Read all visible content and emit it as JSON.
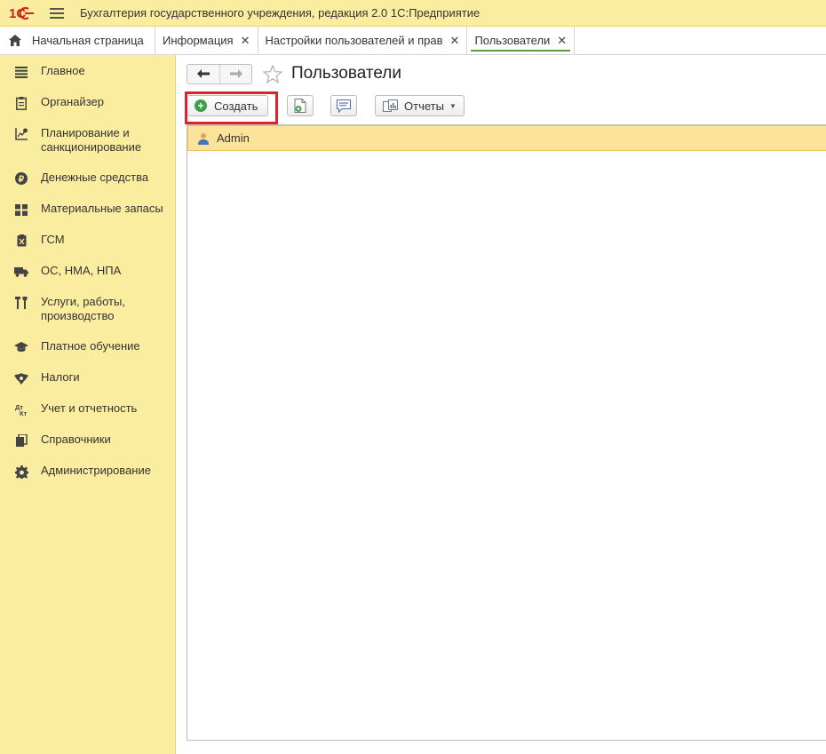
{
  "app": {
    "title": "Бухгалтерия государственного учреждения, редакция 2.0 1С:Предприятие",
    "brand_color": "#fbeda0",
    "accent_color": "#5a9e3e",
    "highlight_color": "#e0202a"
  },
  "tabs": [
    {
      "label": "Начальная страница",
      "icon": "home-icon",
      "closable": false,
      "active": false
    },
    {
      "label": "Информация",
      "closable": true,
      "active": false
    },
    {
      "label": "Настройки пользователей и прав",
      "closable": true,
      "active": false
    },
    {
      "label": "Пользователи",
      "closable": true,
      "active": true
    }
  ],
  "sidebar": {
    "items": [
      {
        "label": "Главное",
        "icon": "list-icon"
      },
      {
        "label": "Органайзер",
        "icon": "clipboard-icon"
      },
      {
        "label": "Планирование и санкционирование",
        "icon": "planning-icon"
      },
      {
        "label": "Денежные средства",
        "icon": "ruble-icon"
      },
      {
        "label": "Материальные запасы",
        "icon": "warehouse-icon"
      },
      {
        "label": "ГСМ",
        "icon": "fuel-icon"
      },
      {
        "label": "ОС, НМА, НПА",
        "icon": "truck-icon"
      },
      {
        "label": "Услуги, работы, производство",
        "icon": "tools-icon"
      },
      {
        "label": "Платное обучение",
        "icon": "graduation-cap-icon"
      },
      {
        "label": "Налоги",
        "icon": "emblem-icon"
      },
      {
        "label": "Учет и отчетность",
        "icon": "debit-credit-icon"
      },
      {
        "label": "Справочники",
        "icon": "books-icon"
      },
      {
        "label": "Администрирование",
        "icon": "gear-icon"
      }
    ]
  },
  "page": {
    "title": "Пользователи"
  },
  "toolbar": {
    "create_label": "Создать",
    "reports_label": "Отчеты"
  },
  "list": {
    "rows": [
      {
        "name": "Admin",
        "icon": "user-icon",
        "selected": true
      }
    ]
  }
}
